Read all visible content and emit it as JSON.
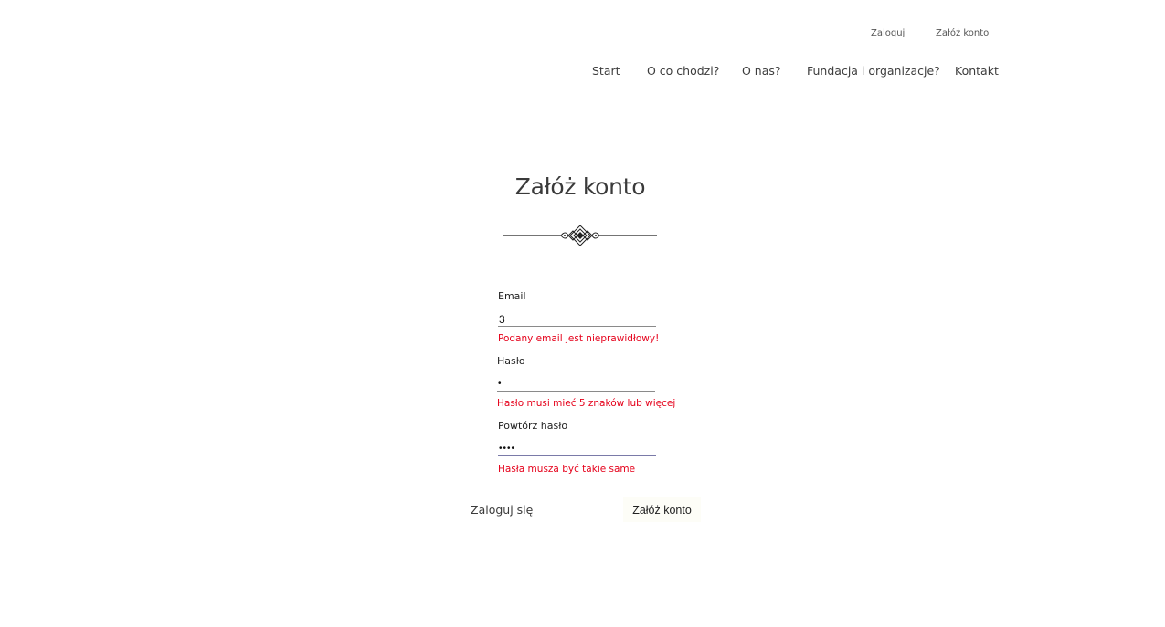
{
  "top_links": {
    "login": "Zaloguj",
    "register": "Załóż konto"
  },
  "nav": {
    "start": "Start",
    "what": "O co chodzi?",
    "about": "O nas?",
    "foundation": "Fundacja i organizacje?",
    "contact": "Kontakt"
  },
  "page": {
    "title": "Załóż konto",
    "divider_icon": "ornamental-divider-icon"
  },
  "form": {
    "email": {
      "label": "Email",
      "value": "3",
      "error": "Podany email jest nieprawidłowy!"
    },
    "password": {
      "label": "Hasło",
      "value": "•",
      "error": "Hasło musi mieć 5 znaków lub więcej"
    },
    "repeat_password": {
      "label": "Powtórz hasło",
      "value": "••••",
      "error": "Hasła musza być takie same"
    },
    "login_link": "Zaloguj się",
    "submit_label": "Załóż konto"
  },
  "colors": {
    "error": "#e5001a",
    "text": "#3c3c3c",
    "button_bg": "#fdfdf7"
  }
}
